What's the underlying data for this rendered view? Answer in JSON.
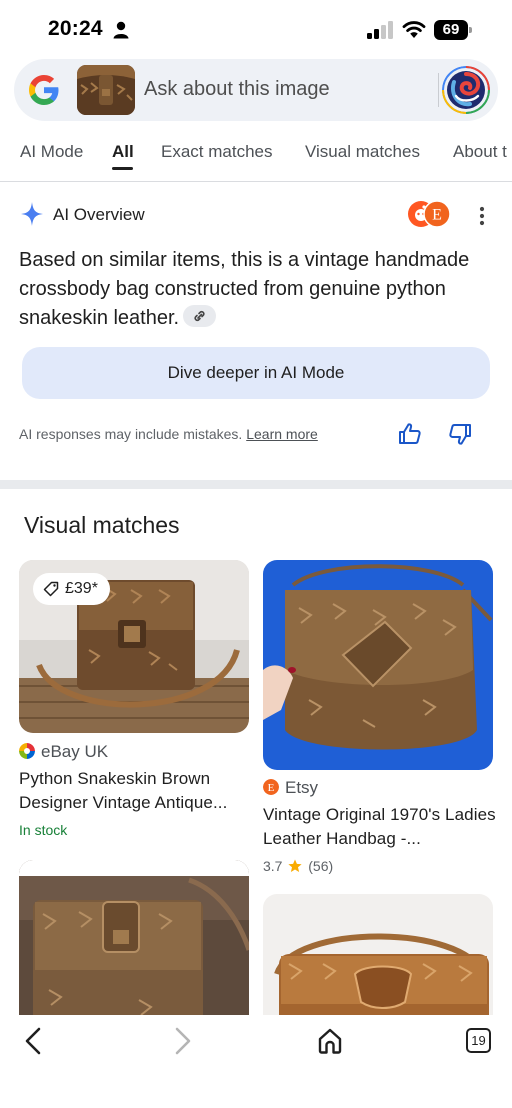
{
  "status_bar": {
    "time": "20:24",
    "battery": "69"
  },
  "search": {
    "placeholder": "Ask about this image"
  },
  "tabs": [
    {
      "label": "AI Mode"
    },
    {
      "label": "All",
      "active": true
    },
    {
      "label": "Exact matches"
    },
    {
      "label": "Visual matches"
    },
    {
      "label": "About t"
    }
  ],
  "ai_overview": {
    "title": "AI Overview",
    "text": "Based on similar items, this is a vintage handmade crossbody bag constructed from genuine python snakeskin leather.",
    "dive_button": "Dive deeper in AI Mode",
    "disclaimer": "AI responses may include mistakes.",
    "learn_more": "Learn more"
  },
  "visual_matches": {
    "heading": "Visual matches",
    "items": [
      {
        "price": "£39*",
        "source": "eBay UK",
        "title": "Python Snakeskin Brown Designer Vintage Antique...",
        "stock": "In stock"
      },
      {
        "source": "Etsy",
        "title": "Vintage Original 1970's Ladies Leather Handbag -...",
        "rating": "3.7",
        "reviews": "(56)"
      }
    ]
  },
  "bottom_nav": {
    "tab_count": "19"
  },
  "colors": {
    "accent_blue": "#1a73e8",
    "dive_bg": "#e1e9fa",
    "stock_green": "#188038",
    "star": "#f9ab00",
    "etsy": "#f1641e"
  }
}
